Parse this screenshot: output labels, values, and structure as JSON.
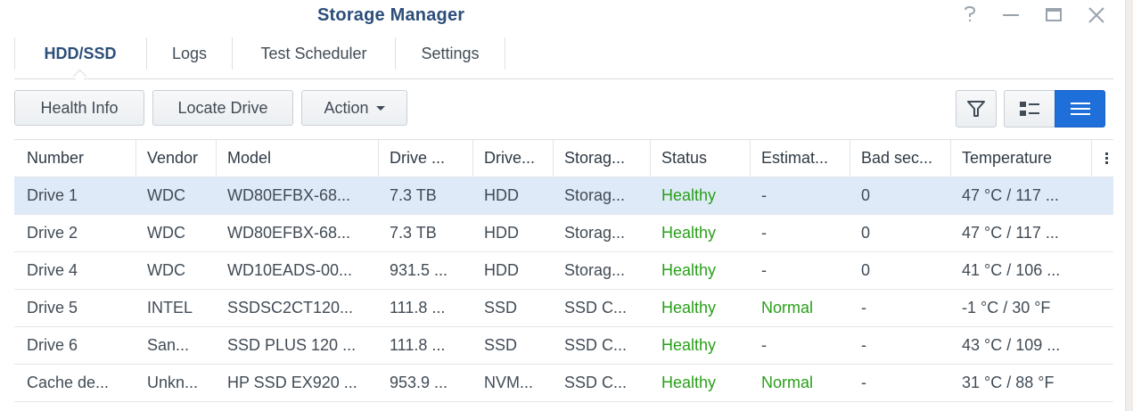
{
  "window": {
    "title": "Storage Manager",
    "controls": [
      "help-icon",
      "minimize-icon",
      "maximize-icon",
      "close-icon"
    ]
  },
  "tabs": [
    {
      "label": "HDD/SSD",
      "active": true
    },
    {
      "label": "Logs",
      "active": false
    },
    {
      "label": "Test Scheduler",
      "active": false
    },
    {
      "label": "Settings",
      "active": false
    }
  ],
  "toolbar": {
    "health_info_label": "Health Info",
    "locate_drive_label": "Locate Drive",
    "action_label": "Action",
    "filter_icon": "filter-icon",
    "view_icons": [
      "list-detail-view-icon",
      "list-view-icon"
    ],
    "active_view": "list-view-icon",
    "accent_color": "#1e6fd9"
  },
  "table": {
    "columns": [
      "Number",
      "Vendor",
      "Model",
      "Drive ...",
      "Drive...",
      "Storag...",
      "Status",
      "Estimat...",
      "Bad sec...",
      "Temperature"
    ],
    "rows": [
      {
        "number": "Drive 1",
        "vendor": "WDC",
        "model": "WD80EFBX-68...",
        "size": "7.3 TB",
        "type": "HDD",
        "storage": "Storag...",
        "status": "Healthy",
        "estimate": "-",
        "bad": "0",
        "temp": "47 °C / 117 ...",
        "selected": true
      },
      {
        "number": "Drive 2",
        "vendor": "WDC",
        "model": "WD80EFBX-68...",
        "size": "7.3 TB",
        "type": "HDD",
        "storage": "Storag...",
        "status": "Healthy",
        "estimate": "-",
        "bad": "0",
        "temp": "47 °C / 117 ..."
      },
      {
        "number": "Drive 4",
        "vendor": "WDC",
        "model": "WD10EADS-00...",
        "size": "931.5 ...",
        "type": "HDD",
        "storage": "Storag...",
        "status": "Healthy",
        "estimate": "-",
        "bad": "0",
        "temp": "41 °C / 106 ..."
      },
      {
        "number": "Drive 5",
        "vendor": "INTEL",
        "model": "SSDSC2CT120...",
        "size": "111.8 ...",
        "type": "SSD",
        "storage": "SSD C...",
        "status": "Healthy",
        "estimate": "Normal",
        "bad": "-",
        "temp": "-1 °C / 30 °F"
      },
      {
        "number": "Drive 6",
        "vendor": "San...",
        "model": "SSD PLUS 120 ...",
        "size": "111.8 ...",
        "type": "SSD",
        "storage": "SSD C...",
        "status": "Healthy",
        "estimate": "-",
        "bad": "-",
        "temp": "43 °C / 109 ..."
      },
      {
        "number": "Cache de...",
        "vendor": "Unkn...",
        "model": "HP SSD EX920 ...",
        "size": "953.9 ...",
        "type": "NVM...",
        "storage": "SSD C...",
        "status": "Healthy",
        "estimate": "Normal",
        "bad": "-",
        "temp": "31 °C / 88 °F"
      }
    ],
    "status_color": "#28a018",
    "selected_row_color": "#dfeaf9"
  }
}
